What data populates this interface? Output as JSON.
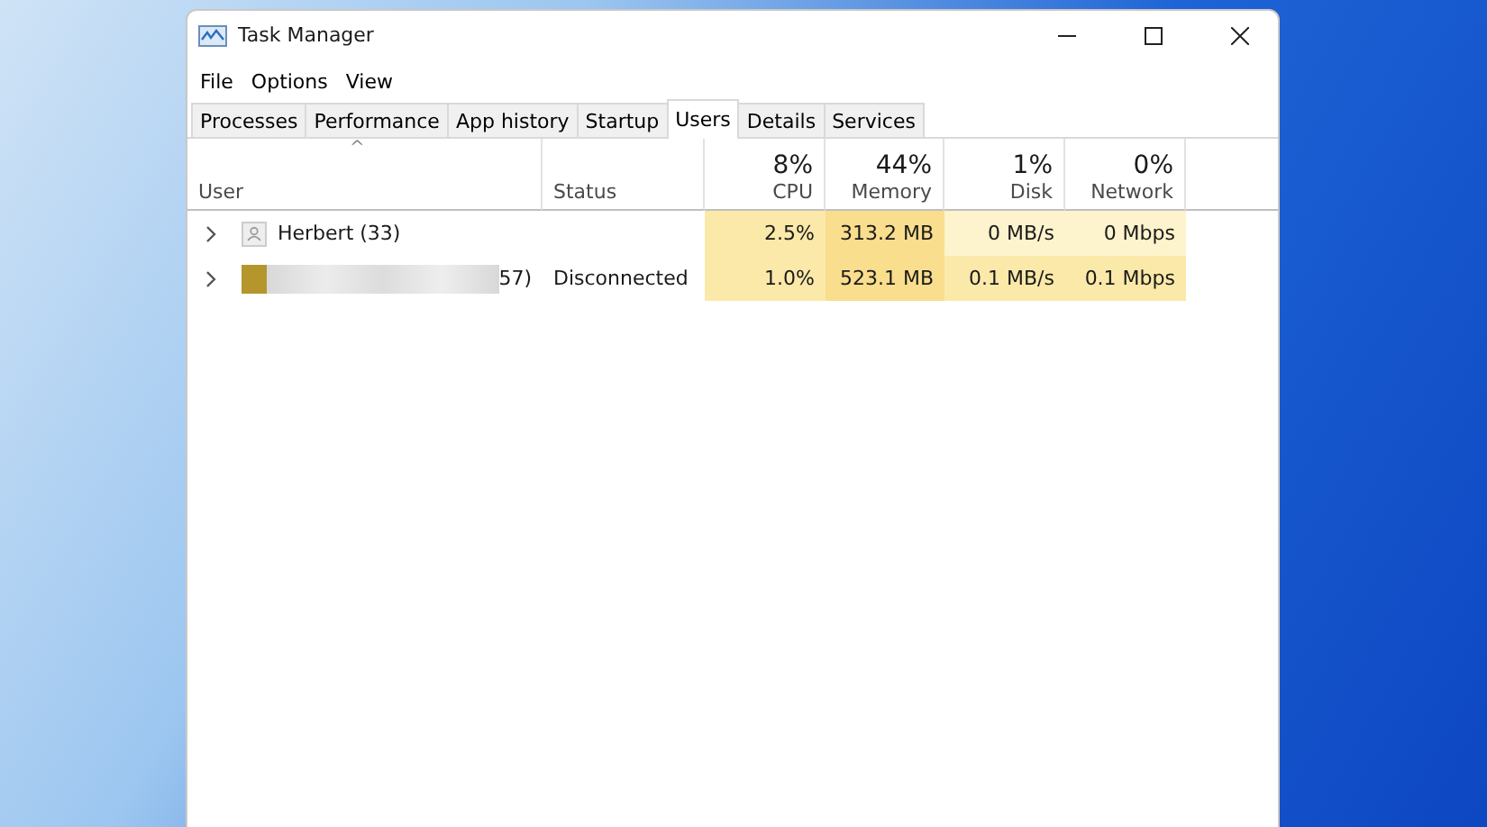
{
  "window": {
    "title": "Task Manager"
  },
  "menu": [
    "File",
    "Options",
    "View"
  ],
  "tabs": [
    {
      "label": "Processes",
      "selected": false
    },
    {
      "label": "Performance",
      "selected": false
    },
    {
      "label": "App history",
      "selected": false
    },
    {
      "label": "Startup",
      "selected": false
    },
    {
      "label": "Users",
      "selected": true
    },
    {
      "label": "Details",
      "selected": false
    },
    {
      "label": "Services",
      "selected": false
    }
  ],
  "table": {
    "sort_indicator": "^",
    "columns": [
      {
        "label": "User"
      },
      {
        "label": "Status"
      },
      {
        "label": "CPU",
        "total": "8%"
      },
      {
        "label": "Memory",
        "total": "44%"
      },
      {
        "label": "Disk",
        "total": "1%"
      },
      {
        "label": "Network",
        "total": "0%"
      }
    ],
    "rows": [
      {
        "expanded": false,
        "redacted": false,
        "cells": [
          "Herbert (33)",
          "",
          {
            "text": "2.5%",
            "color": "#fbe9a9"
          },
          {
            "text": "313.2 MB",
            "color": "#f9de8e"
          },
          {
            "text": "0 MB/s",
            "color": "#fdf3cc"
          },
          {
            "text": "0 Mbps",
            "color": "#fdf3cc"
          }
        ]
      },
      {
        "expanded": false,
        "redacted": true,
        "cells": [
          "57)",
          "Disconnected",
          {
            "text": "1.0%",
            "color": "#fbe9a9"
          },
          {
            "text": "523.1 MB",
            "color": "#f9de8e"
          },
          {
            "text": "0.1 MB/s",
            "color": "#fbe9a9"
          },
          {
            "text": "0.1 Mbps",
            "color": "#fbe9a9"
          }
        ]
      }
    ]
  }
}
